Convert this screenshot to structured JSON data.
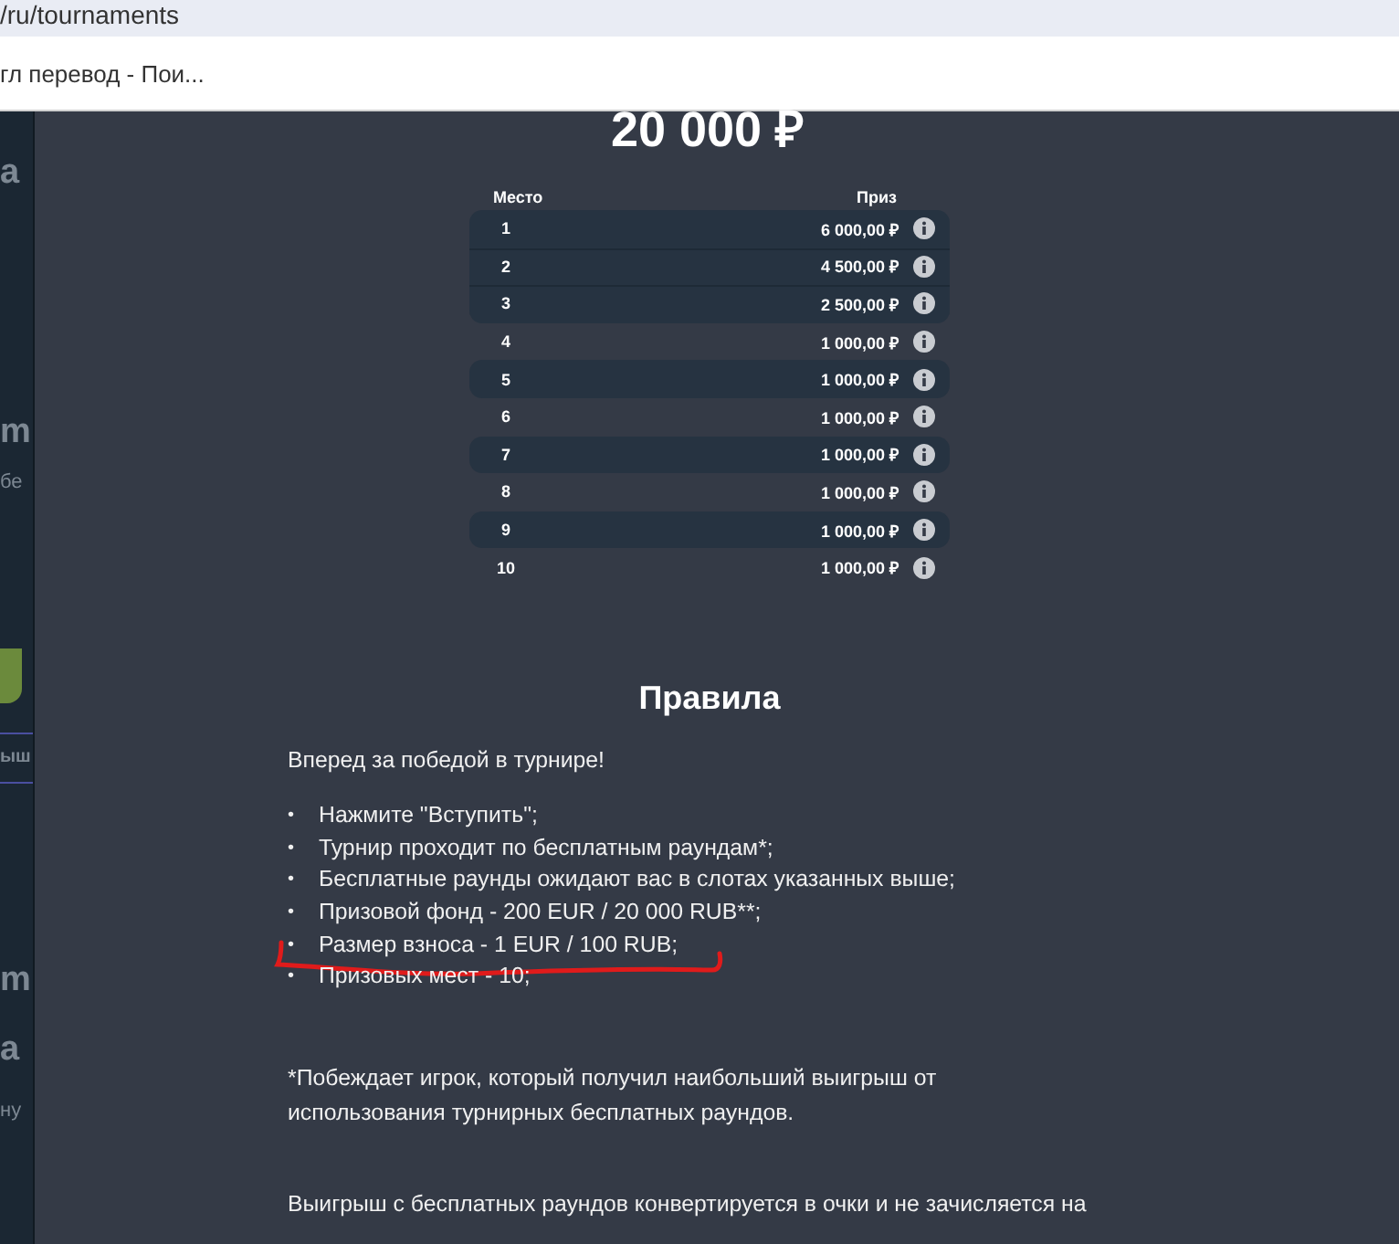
{
  "browser": {
    "address": "/ru/tournaments",
    "bookmark": "гл перевод - Пои..."
  },
  "background_page": {
    "fragments": [
      {
        "text": "a",
        "kind": "big"
      },
      {
        "text": "m",
        "kind": "big"
      },
      {
        "text": "бе",
        "kind": "small"
      },
      {
        "kind": "button"
      },
      {
        "text": "ыш",
        "kind": "tab"
      },
      {
        "text": "m",
        "kind": "big"
      },
      {
        "text": "a",
        "kind": "big"
      },
      {
        "text": "ну",
        "kind": "small"
      }
    ]
  },
  "prize_pool": "20 000 ₽",
  "table": {
    "columns": [
      "Место",
      "Приз"
    ],
    "rows": [
      {
        "place": "1",
        "prize": "6 000,00 ₽",
        "highlighted": true
      },
      {
        "place": "2",
        "prize": "4 500,00 ₽",
        "highlighted": true
      },
      {
        "place": "3",
        "prize": "2 500,00 ₽",
        "highlighted": true
      },
      {
        "place": "4",
        "prize": "1 000,00 ₽",
        "highlighted": false
      },
      {
        "place": "5",
        "prize": "1 000,00 ₽",
        "highlighted": true
      },
      {
        "place": "6",
        "prize": "1 000,00 ₽",
        "highlighted": false
      },
      {
        "place": "7",
        "prize": "1 000,00 ₽",
        "highlighted": true
      },
      {
        "place": "8",
        "prize": "1 000,00 ₽",
        "highlighted": false
      },
      {
        "place": "9",
        "prize": "1 000,00 ₽",
        "highlighted": true
      },
      {
        "place": "10",
        "prize": "1 000,00 ₽",
        "highlighted": false
      }
    ]
  },
  "rules": {
    "title": "Правила",
    "intro": "Вперед за победой в турнире!",
    "bullet": "•",
    "items": [
      {
        "text": "Нажмите \"Вступить\";",
        "underlined": false
      },
      {
        "text": "Турнир проходит по бесплатным раундам*;",
        "underlined": false
      },
      {
        "text": "Бесплатные раунды ожидают вас в слотах указанных выше;",
        "underlined": false
      },
      {
        "text": "Призовой фонд - 200 EUR / 20 000 RUB**;",
        "underlined": false
      },
      {
        "text": "Размер взноса - 1 EUR / 100 RUB;",
        "underlined": true
      },
      {
        "text": "Призовых мест - 10;",
        "underlined": false
      }
    ],
    "footnote": "*Побеждает игрок, который получил наибольший выигрыш от использования турнирных бесплатных раундов.",
    "last_paragraph": "Выигрыш с бесплатных раундов конвертируется в очки и не зачисляется на"
  },
  "annotation": {
    "color": "#e01b1b"
  }
}
